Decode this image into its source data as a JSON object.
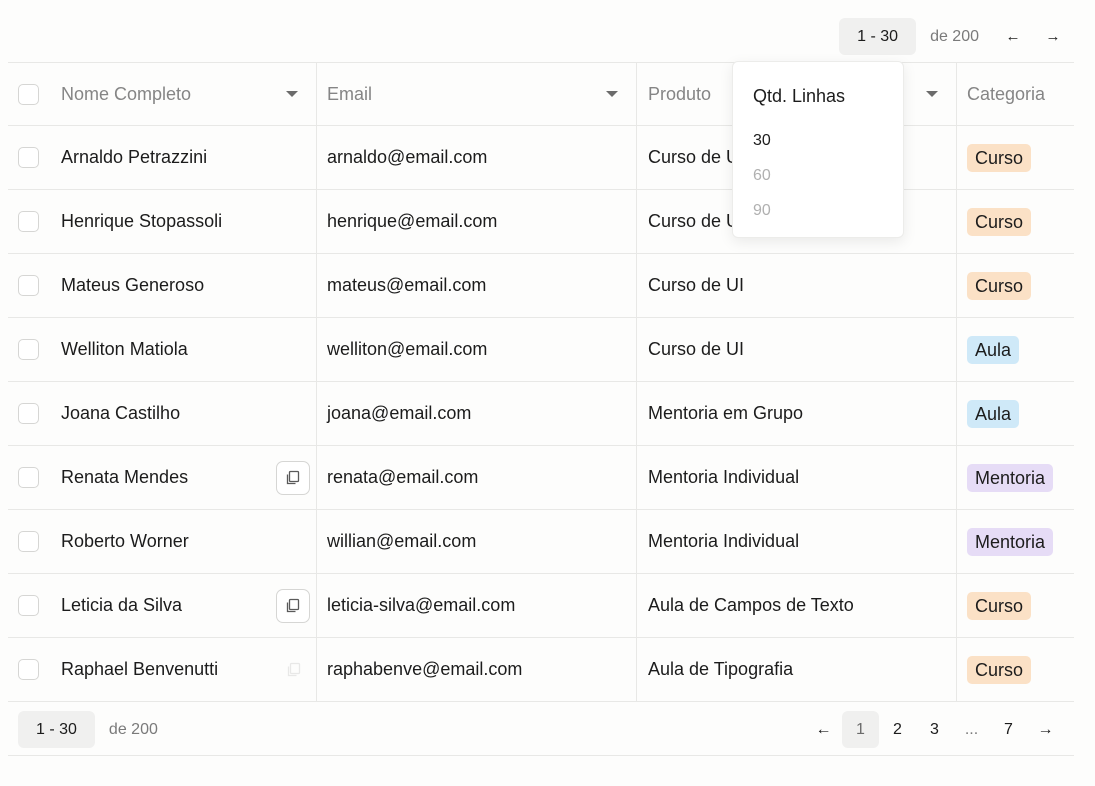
{
  "pager_top": {
    "range": "1 - 30",
    "total": "de 200",
    "prev_icon": "←",
    "next_icon": "→"
  },
  "columns": {
    "name": "Nome Completo",
    "email": "Email",
    "product": "Produto",
    "category": "Categoria"
  },
  "rows": [
    {
      "name": "Arnaldo Petrazzini",
      "email": "arnaldo@email.com",
      "product": "Curso de UI",
      "category": "Curso",
      "category_type": "curso"
    },
    {
      "name": "Henrique Stopassoli",
      "email": "henrique@email.com",
      "product": "Curso de UI",
      "category": "Curso",
      "category_type": "curso"
    },
    {
      "name": "Mateus Generoso",
      "email": "mateus@email.com",
      "product": "Curso de UI",
      "category": "Curso",
      "category_type": "curso"
    },
    {
      "name": "Welliton Matiola",
      "email": "welliton@email.com",
      "product": "Curso de UI",
      "category": "Aula",
      "category_type": "aula"
    },
    {
      "name": "Joana Castilho",
      "email": "joana@email.com",
      "product": "Mentoria em Grupo",
      "category": "Aula",
      "category_type": "aula"
    },
    {
      "name": "Renata Mendes",
      "email": "renata@email.com",
      "product": "Mentoria Individual",
      "category": "Mentoria",
      "category_type": "mentoria",
      "copy": true
    },
    {
      "name": "Roberto Worner",
      "email": "willian@email.com",
      "product": "Mentoria Individual",
      "category": "Mentoria",
      "category_type": "mentoria"
    },
    {
      "name": "Leticia da Silva",
      "email": "leticia-silva@email.com",
      "product": "Aula de Campos de Texto",
      "category": "Curso",
      "category_type": "curso",
      "copy": true
    },
    {
      "name": "Raphael Benvenutti",
      "email": "raphabenve@email.com",
      "product": "Aula de Tipografia",
      "category": "Curso",
      "category_type": "curso"
    }
  ],
  "rows_dropdown": {
    "title": "Qtd. Linhas",
    "options": [
      "30",
      "60",
      "90"
    ],
    "selected": "30"
  },
  "pager_bottom": {
    "range": "1 - 30",
    "total": "de 200",
    "prev_icon": "←",
    "next_icon": "→",
    "pages": [
      "1",
      "2",
      "3",
      "...",
      "7"
    ],
    "current": "1"
  },
  "colors": {
    "curso": "#fbe1c6",
    "aula": "#cfe9f8",
    "mentoria": "#e6dcf6"
  }
}
